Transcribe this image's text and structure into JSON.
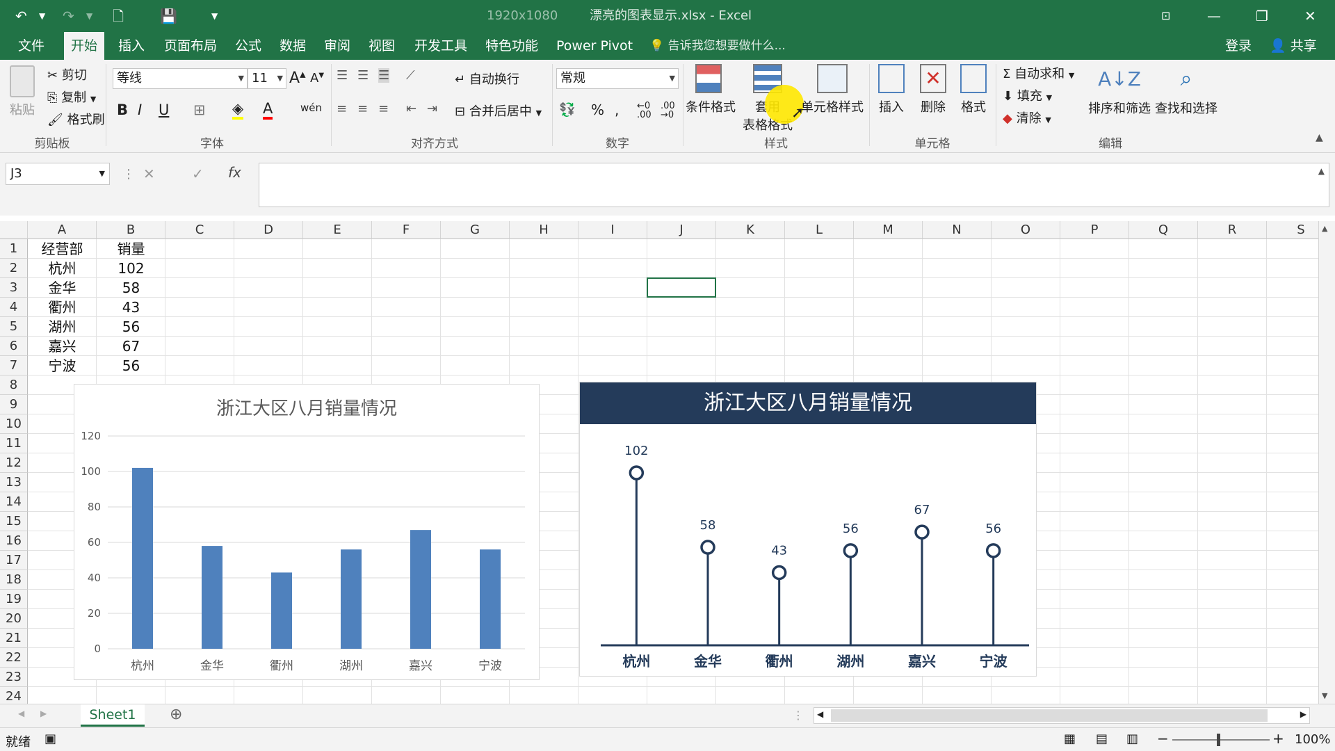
{
  "titlebar": {
    "title": "漂亮的图表显示.xlsx - Excel",
    "resolution": "1920x1080"
  },
  "menu": {
    "tabs": [
      "文件",
      "开始",
      "插入",
      "页面布局",
      "公式",
      "数据",
      "审阅",
      "视图",
      "开发工具",
      "特色功能",
      "Power Pivot"
    ],
    "active": "开始",
    "tellme": "告诉我您想要做什么...",
    "login": "登录",
    "share": "共享"
  },
  "ribbon": {
    "clipboard": {
      "paste": "粘贴",
      "cut": "剪切",
      "copy": "复制",
      "format_painter": "格式刷",
      "label": "剪贴板"
    },
    "font": {
      "name": "等线",
      "size": "11",
      "label": "字体"
    },
    "align": {
      "wrap": "自动换行",
      "merge": "合并后居中",
      "label": "对齐方式"
    },
    "number": {
      "format": "常规",
      "label": "数字"
    },
    "styles": {
      "cond": "条件格式",
      "table1": "套用",
      "table2": "表格格式",
      "cell": "单元格样式",
      "label": "样式"
    },
    "cells": {
      "insert": "插入",
      "delete": "删除",
      "format": "格式",
      "label": "单元格"
    },
    "editing": {
      "autosum": "自动求和",
      "fill": "填充",
      "clear": "清除",
      "sort": "排序和筛选",
      "find": "查找和选择",
      "label": "编辑"
    }
  },
  "formula_bar": {
    "namebox": "J3",
    "fx": "fx",
    "content": ""
  },
  "columns": [
    "A",
    "B",
    "C",
    "D",
    "E",
    "F",
    "G",
    "H",
    "I",
    "J",
    "K",
    "L",
    "M",
    "N",
    "O",
    "P",
    "Q",
    "R",
    "S"
  ],
  "rows": [
    "1",
    "2",
    "3",
    "4",
    "5",
    "6",
    "7",
    "8",
    "9",
    "10",
    "11",
    "12",
    "13",
    "14",
    "15",
    "16",
    "17",
    "18",
    "19",
    "20",
    "21",
    "22",
    "23",
    "24"
  ],
  "table": {
    "headers": [
      "经营部",
      "销量"
    ],
    "rows": [
      [
        "杭州",
        "102"
      ],
      [
        "金华",
        "58"
      ],
      [
        "衢州",
        "43"
      ],
      [
        "湖州",
        "56"
      ],
      [
        "嘉兴",
        "67"
      ],
      [
        "宁波",
        "56"
      ]
    ]
  },
  "chart_data": [
    {
      "type": "bar",
      "title": "浙江大区八月销量情况",
      "categories": [
        "杭州",
        "金华",
        "衢州",
        "湖州",
        "嘉兴",
        "宁波"
      ],
      "values": [
        102,
        58,
        43,
        56,
        67,
        56
      ],
      "ylim": [
        0,
        120
      ],
      "yticks": [
        0,
        20,
        40,
        60,
        80,
        100,
        120
      ],
      "grid": true,
      "color": "#4f81bd"
    },
    {
      "type": "lollipop",
      "title": "浙江大区八月销量情况",
      "categories": [
        "杭州",
        "金华",
        "衢州",
        "湖州",
        "嘉兴",
        "宁波"
      ],
      "values": [
        102,
        58,
        43,
        56,
        67,
        56
      ],
      "data_labels": true,
      "color": "#243b5a"
    }
  ],
  "sheets": {
    "active": "Sheet1"
  },
  "status": {
    "ready": "就绪",
    "zoom": "100%"
  },
  "colors": {
    "excel_green": "#217346",
    "bar_blue": "#4f81bd",
    "navy": "#243b5a"
  }
}
